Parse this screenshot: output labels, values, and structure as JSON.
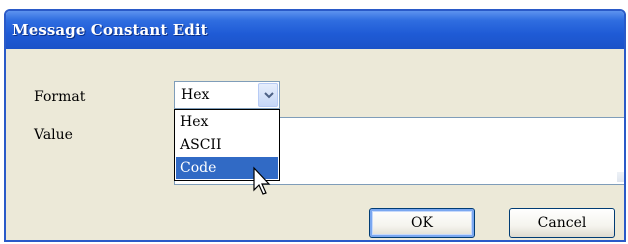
{
  "window": {
    "title": "Message Constant Edit"
  },
  "form": {
    "format_label": "Format",
    "value_label": "Value",
    "format_selected": "Hex",
    "value_text": ""
  },
  "dropdown": {
    "options": [
      "Hex",
      "ASCII",
      "Code"
    ],
    "highlighted": "Code"
  },
  "buttons": {
    "ok": "OK",
    "cancel": "Cancel"
  },
  "colors": {
    "titlebar": "#1f5bd6",
    "selection": "#316ac5",
    "dialog_bg": "#ece9d8"
  },
  "icons": {
    "combo_button": "chevron-down-icon",
    "pointer": "mouse-pointer-icon"
  }
}
